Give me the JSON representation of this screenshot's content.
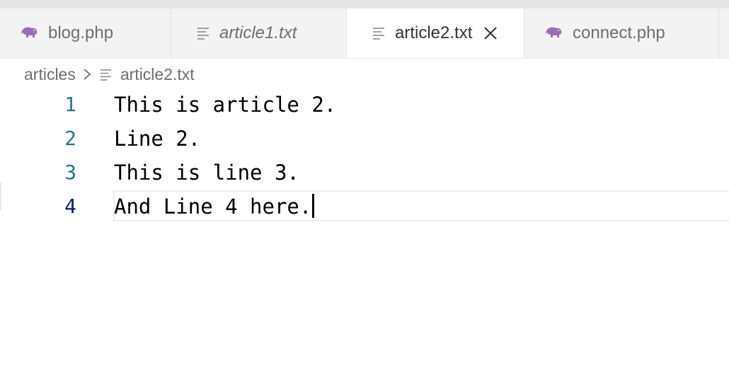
{
  "tabs": [
    {
      "label": "blog.php",
      "icon": "php-elephant-icon",
      "active": false,
      "italic": false
    },
    {
      "label": "article1.txt",
      "icon": "text-file-icon",
      "active": false,
      "italic": true
    },
    {
      "label": "article2.txt",
      "icon": "text-file-icon",
      "active": true,
      "italic": false
    },
    {
      "label": "connect.php",
      "icon": "php-elephant-icon",
      "active": false,
      "italic": false
    }
  ],
  "breadcrumb": {
    "folder": "articles",
    "file": "article2.txt"
  },
  "editor": {
    "lines": [
      {
        "number": "1",
        "text": "This is article 2."
      },
      {
        "number": "2",
        "text": "Line 2."
      },
      {
        "number": "3",
        "text": "This is line 3."
      },
      {
        "number": "4",
        "text": "And Line 4 here."
      }
    ],
    "active_line": 4
  },
  "colors": {
    "tab_bar_bg": "#f3f3f3",
    "active_tab_bg": "#ffffff",
    "line_number": "#237893",
    "active_line_number": "#0b216f",
    "php_icon": "#9b6bb8"
  }
}
